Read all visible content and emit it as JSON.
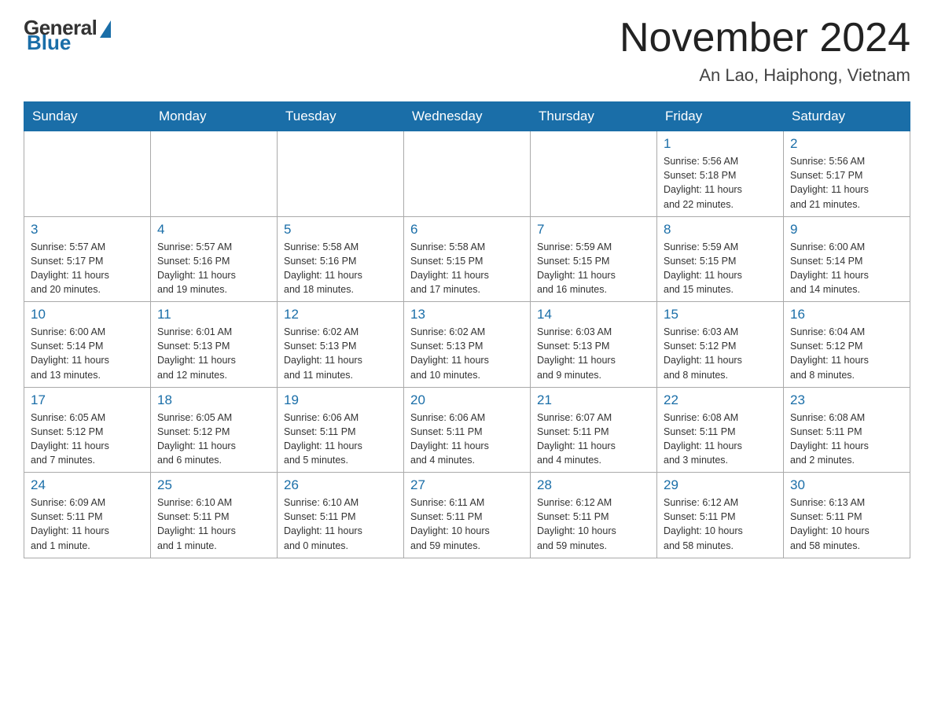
{
  "logo": {
    "general": "General",
    "blue": "Blue"
  },
  "title": {
    "month_year": "November 2024",
    "location": "An Lao, Haiphong, Vietnam"
  },
  "weekdays": [
    "Sunday",
    "Monday",
    "Tuesday",
    "Wednesday",
    "Thursday",
    "Friday",
    "Saturday"
  ],
  "weeks": [
    [
      {
        "day": "",
        "info": ""
      },
      {
        "day": "",
        "info": ""
      },
      {
        "day": "",
        "info": ""
      },
      {
        "day": "",
        "info": ""
      },
      {
        "day": "",
        "info": ""
      },
      {
        "day": "1",
        "info": "Sunrise: 5:56 AM\nSunset: 5:18 PM\nDaylight: 11 hours\nand 22 minutes."
      },
      {
        "day": "2",
        "info": "Sunrise: 5:56 AM\nSunset: 5:17 PM\nDaylight: 11 hours\nand 21 minutes."
      }
    ],
    [
      {
        "day": "3",
        "info": "Sunrise: 5:57 AM\nSunset: 5:17 PM\nDaylight: 11 hours\nand 20 minutes."
      },
      {
        "day": "4",
        "info": "Sunrise: 5:57 AM\nSunset: 5:16 PM\nDaylight: 11 hours\nand 19 minutes."
      },
      {
        "day": "5",
        "info": "Sunrise: 5:58 AM\nSunset: 5:16 PM\nDaylight: 11 hours\nand 18 minutes."
      },
      {
        "day": "6",
        "info": "Sunrise: 5:58 AM\nSunset: 5:15 PM\nDaylight: 11 hours\nand 17 minutes."
      },
      {
        "day": "7",
        "info": "Sunrise: 5:59 AM\nSunset: 5:15 PM\nDaylight: 11 hours\nand 16 minutes."
      },
      {
        "day": "8",
        "info": "Sunrise: 5:59 AM\nSunset: 5:15 PM\nDaylight: 11 hours\nand 15 minutes."
      },
      {
        "day": "9",
        "info": "Sunrise: 6:00 AM\nSunset: 5:14 PM\nDaylight: 11 hours\nand 14 minutes."
      }
    ],
    [
      {
        "day": "10",
        "info": "Sunrise: 6:00 AM\nSunset: 5:14 PM\nDaylight: 11 hours\nand 13 minutes."
      },
      {
        "day": "11",
        "info": "Sunrise: 6:01 AM\nSunset: 5:13 PM\nDaylight: 11 hours\nand 12 minutes."
      },
      {
        "day": "12",
        "info": "Sunrise: 6:02 AM\nSunset: 5:13 PM\nDaylight: 11 hours\nand 11 minutes."
      },
      {
        "day": "13",
        "info": "Sunrise: 6:02 AM\nSunset: 5:13 PM\nDaylight: 11 hours\nand 10 minutes."
      },
      {
        "day": "14",
        "info": "Sunrise: 6:03 AM\nSunset: 5:13 PM\nDaylight: 11 hours\nand 9 minutes."
      },
      {
        "day": "15",
        "info": "Sunrise: 6:03 AM\nSunset: 5:12 PM\nDaylight: 11 hours\nand 8 minutes."
      },
      {
        "day": "16",
        "info": "Sunrise: 6:04 AM\nSunset: 5:12 PM\nDaylight: 11 hours\nand 8 minutes."
      }
    ],
    [
      {
        "day": "17",
        "info": "Sunrise: 6:05 AM\nSunset: 5:12 PM\nDaylight: 11 hours\nand 7 minutes."
      },
      {
        "day": "18",
        "info": "Sunrise: 6:05 AM\nSunset: 5:12 PM\nDaylight: 11 hours\nand 6 minutes."
      },
      {
        "day": "19",
        "info": "Sunrise: 6:06 AM\nSunset: 5:11 PM\nDaylight: 11 hours\nand 5 minutes."
      },
      {
        "day": "20",
        "info": "Sunrise: 6:06 AM\nSunset: 5:11 PM\nDaylight: 11 hours\nand 4 minutes."
      },
      {
        "day": "21",
        "info": "Sunrise: 6:07 AM\nSunset: 5:11 PM\nDaylight: 11 hours\nand 4 minutes."
      },
      {
        "day": "22",
        "info": "Sunrise: 6:08 AM\nSunset: 5:11 PM\nDaylight: 11 hours\nand 3 minutes."
      },
      {
        "day": "23",
        "info": "Sunrise: 6:08 AM\nSunset: 5:11 PM\nDaylight: 11 hours\nand 2 minutes."
      }
    ],
    [
      {
        "day": "24",
        "info": "Sunrise: 6:09 AM\nSunset: 5:11 PM\nDaylight: 11 hours\nand 1 minute."
      },
      {
        "day": "25",
        "info": "Sunrise: 6:10 AM\nSunset: 5:11 PM\nDaylight: 11 hours\nand 1 minute."
      },
      {
        "day": "26",
        "info": "Sunrise: 6:10 AM\nSunset: 5:11 PM\nDaylight: 11 hours\nand 0 minutes."
      },
      {
        "day": "27",
        "info": "Sunrise: 6:11 AM\nSunset: 5:11 PM\nDaylight: 10 hours\nand 59 minutes."
      },
      {
        "day": "28",
        "info": "Sunrise: 6:12 AM\nSunset: 5:11 PM\nDaylight: 10 hours\nand 59 minutes."
      },
      {
        "day": "29",
        "info": "Sunrise: 6:12 AM\nSunset: 5:11 PM\nDaylight: 10 hours\nand 58 minutes."
      },
      {
        "day": "30",
        "info": "Sunrise: 6:13 AM\nSunset: 5:11 PM\nDaylight: 10 hours\nand 58 minutes."
      }
    ]
  ]
}
